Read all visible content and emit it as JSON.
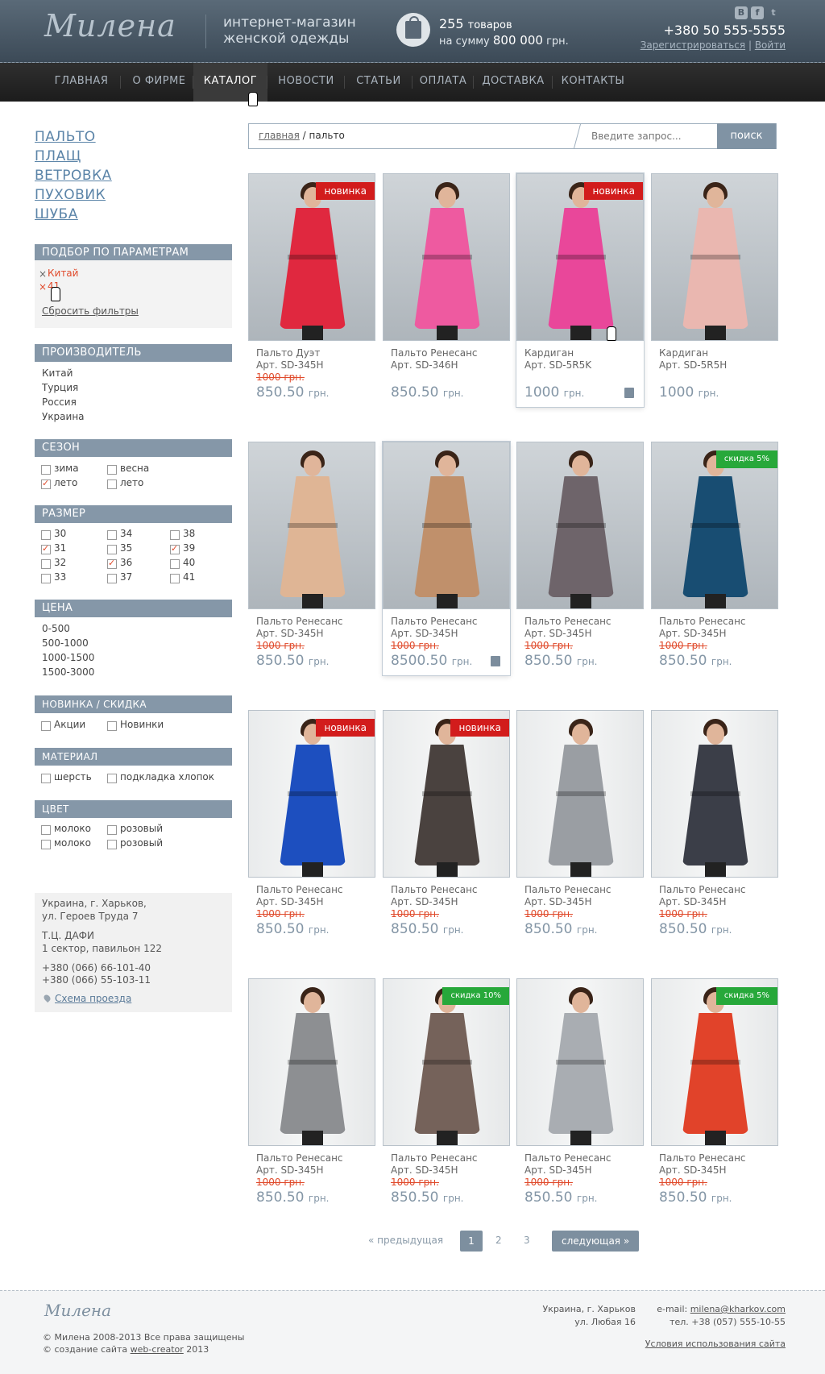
{
  "header": {
    "logo": "Милена",
    "tagline": "интернет-магазин женской одежды",
    "cart_count": "255",
    "cart_count_suffix": "товаров",
    "cart_sum_prefix": "на сумму",
    "cart_sum": "800 000",
    "cart_sum_suffix": "грн.",
    "social": [
      "В",
      "f",
      "t"
    ],
    "phone": "+380 50 555-5555",
    "register": "Зарегистрироваться",
    "separator": "|",
    "login": "Войти"
  },
  "nav": [
    "ГЛАВНАЯ",
    "О ФИРМЕ",
    "КАТАЛОГ",
    "НОВОСТИ",
    "СТАТЬИ",
    "ОПЛАТА",
    "ДОСТАВКА",
    "КОНТАКТЫ"
  ],
  "nav_active": "КАТАЛОГ",
  "categories": [
    "ПАЛЬТО",
    "ПЛАЩ",
    "ВЕТРОВКА",
    "ПУХОВИК",
    "ШУБА"
  ],
  "filters": {
    "title": "ПОДБОР ПО ПАРАМЕТРАМ",
    "selected": [
      "Китай",
      "41"
    ],
    "reset": "Сбросить фильтры",
    "x": "×"
  },
  "manufacturer": {
    "title": "ПРОИЗВОДИТЕЛЬ",
    "items": [
      "Китай",
      "Турция",
      "Россия",
      "Украина"
    ]
  },
  "season": {
    "title": "СЕЗОН",
    "items": [
      {
        "label": "зима",
        "checked": false
      },
      {
        "label": "весна",
        "checked": false
      },
      {
        "label": "лето",
        "checked": true
      },
      {
        "label": "лето",
        "checked": false
      }
    ]
  },
  "size": {
    "title": "РАЗМЕР",
    "items": [
      {
        "label": "30",
        "checked": false
      },
      {
        "label": "34",
        "checked": false
      },
      {
        "label": "38",
        "checked": false
      },
      {
        "label": "31",
        "checked": true
      },
      {
        "label": "35",
        "checked": false
      },
      {
        "label": "39",
        "checked": true
      },
      {
        "label": "32",
        "checked": false
      },
      {
        "label": "36",
        "checked": true
      },
      {
        "label": "40",
        "checked": false
      },
      {
        "label": "33",
        "checked": false
      },
      {
        "label": "37",
        "checked": false
      },
      {
        "label": "41",
        "checked": false
      }
    ]
  },
  "price": {
    "title": "ЦЕНА",
    "items": [
      "0-500",
      "500-1000",
      "1000-1500",
      "1500-3000"
    ]
  },
  "novelty": {
    "title": "НОВИНКА / СКИДКА",
    "items": [
      {
        "label": "Акции",
        "checked": false
      },
      {
        "label": "Новинки",
        "checked": false
      }
    ]
  },
  "material": {
    "title": "МАТЕРИАЛ",
    "items": [
      {
        "label": "шерсть",
        "checked": false
      },
      {
        "label": "подкладка хлопок",
        "checked": false
      }
    ]
  },
  "color": {
    "title": "ЦВЕТ",
    "items": [
      {
        "label": "молоко",
        "checked": false
      },
      {
        "label": "розовый",
        "checked": false
      },
      {
        "label": "молоко",
        "checked": false
      },
      {
        "label": "розовый",
        "checked": false
      }
    ]
  },
  "address": {
    "line1": "Украина, г. Харьков,",
    "line2": "ул. Героев Труда 7",
    "line3": "Т.Ц. ДАФИ",
    "line4": "1 сектор, павильон 122",
    "phone1": "+380 (066) 66-101-40",
    "phone2": "+380 (066) 55-103-11",
    "map": "Схема проезда"
  },
  "search": {
    "crumb_home": "главная",
    "crumb_sep": "/",
    "crumb_current": "пальто",
    "placeholder": "Введите запрос...",
    "button": "поиск"
  },
  "products": [
    {
      "name": "Пальто Дуэт",
      "art": "Арт. SD-345H",
      "old": "1000 грн.",
      "price": "850.50",
      "cur": "грн.",
      "badge": "новинка",
      "badge_type": "new",
      "color": "#e0283f",
      "highlight": false,
      "bag": false
    },
    {
      "name": "Пальто Ренесанс",
      "art": "Арт. SD-346H",
      "old": "",
      "price": "850.50",
      "cur": "грн.",
      "badge": "",
      "badge_type": "",
      "color": "#ee5aa0",
      "highlight": false,
      "bag": false
    },
    {
      "name": "Кардиган",
      "art": "Арт. SD-5R5K",
      "old": "",
      "price": "1000",
      "cur": "грн.",
      "badge": "новинка",
      "badge_type": "new",
      "color": "#e9479a",
      "highlight": true,
      "bag": true
    },
    {
      "name": "Кардиган",
      "art": "Арт. SD-5R5H",
      "old": "",
      "price": "1000",
      "cur": "грн.",
      "badge": "",
      "badge_type": "",
      "color": "#eab7b0",
      "highlight": false,
      "bag": false
    },
    {
      "name": "Пальто Ренесанс",
      "art": "Арт. SD-345H",
      "old": "1000 грн.",
      "price": "850.50",
      "cur": "грн.",
      "badge": "",
      "badge_type": "",
      "color": "#dfb595",
      "highlight": false,
      "bag": false
    },
    {
      "name": "Пальто Ренесанс",
      "art": "Арт. SD-345H",
      "old": "1000 грн.",
      "price": "8500.50",
      "cur": "грн.",
      "badge": "",
      "badge_type": "",
      "color": "#c0906b",
      "highlight": true,
      "bag": true
    },
    {
      "name": "Пальто Ренесанс",
      "art": "Арт. SD-345H",
      "old": "1000 грн.",
      "price": "850.50",
      "cur": "грн.",
      "badge": "",
      "badge_type": "",
      "color": "#6e646a",
      "highlight": false,
      "bag": false
    },
    {
      "name": "Пальто Ренесанс",
      "art": "Арт. SD-345H",
      "old": "1000 грн.",
      "price": "850.50",
      "cur": "грн.",
      "badge": "скидка 5%",
      "badge_type": "sale",
      "color": "#184d72",
      "highlight": false,
      "bag": false
    },
    {
      "name": "Пальто Ренесанс",
      "art": "Арт. SD-345H",
      "old": "1000 грн.",
      "price": "850.50",
      "cur": "грн.",
      "badge": "новинка",
      "badge_type": "new",
      "color": "#1d4fbf",
      "highlight": false,
      "bag": false
    },
    {
      "name": "Пальто Ренесанс",
      "art": "Арт. SD-345H",
      "old": "1000 грн.",
      "price": "850.50",
      "cur": "грн.",
      "badge": "новинка",
      "badge_type": "new",
      "color": "#4a423f",
      "highlight": false,
      "bag": false
    },
    {
      "name": "Пальто Ренесанс",
      "art": "Арт. SD-345H",
      "old": "1000 грн.",
      "price": "850.50",
      "cur": "грн.",
      "badge": "",
      "badge_type": "",
      "color": "#9a9ea3",
      "highlight": false,
      "bag": false
    },
    {
      "name": "Пальто Ренесанс",
      "art": "Арт. SD-345H",
      "old": "1000 грн.",
      "price": "850.50",
      "cur": "грн.",
      "badge": "",
      "badge_type": "",
      "color": "#3b3e48",
      "highlight": false,
      "bag": false
    },
    {
      "name": "Пальто Ренесанс",
      "art": "Арт. SD-345H",
      "old": "1000 грн.",
      "price": "850.50",
      "cur": "грн.",
      "badge": "",
      "badge_type": "",
      "color": "#8d8f92",
      "highlight": false,
      "bag": false
    },
    {
      "name": "Пальто Ренесанс",
      "art": "Арт. SD-345H",
      "old": "1000 грн.",
      "price": "850.50",
      "cur": "грн.",
      "badge": "скидка 10%",
      "badge_type": "sale",
      "color": "#75625a",
      "highlight": false,
      "bag": false
    },
    {
      "name": "Пальто Ренесанс",
      "art": "Арт. SD-345H",
      "old": "1000 грн.",
      "price": "850.50",
      "cur": "грн.",
      "badge": "",
      "badge_type": "",
      "color": "#a9adb2",
      "highlight": false,
      "bag": false
    },
    {
      "name": "Пальто Ренесанс",
      "art": "Арт. SD-345H",
      "old": "1000 грн.",
      "price": "850.50",
      "cur": "грн.",
      "badge": "скидка 5%",
      "badge_type": "sale",
      "color": "#e1432a",
      "highlight": false,
      "bag": false
    }
  ],
  "pagination": {
    "prev": "« предыдущая",
    "pages": [
      "1",
      "2",
      "3"
    ],
    "current": "1",
    "next": "следующая »"
  },
  "footer": {
    "logo": "Милена",
    "copyright": "© Милена 2008-2013 Все права защищены",
    "created_prefix": "© создание сайта",
    "created_link": "web-creator",
    "created_year": "2013",
    "city": "Украина, г. Харьков",
    "street": "ул. Любая 16",
    "email_label": "e-mail:",
    "email": "milena@kharkov.com",
    "tel": "тел. +38 (057) 555-10-55",
    "terms": "Условия использования сайта"
  }
}
